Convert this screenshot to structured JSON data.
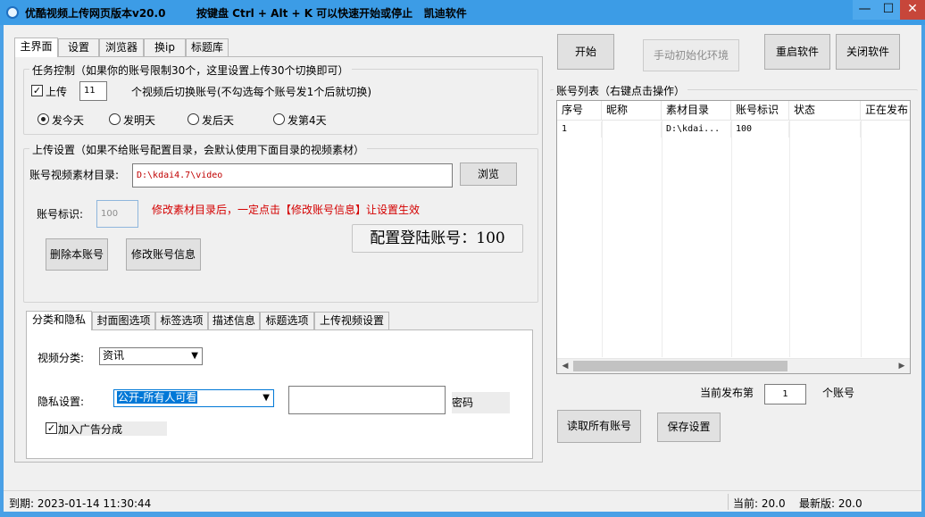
{
  "window": {
    "title": "优酷视频上传网页版本v20.0",
    "hotkey_hint": "按键盘 Ctrl + Alt + K  可以快速开始或停止",
    "company": "凯迪软件",
    "min_glyph": "—",
    "max_glyph": "☐",
    "close_glyph": "✕"
  },
  "tabs": [
    "主界面",
    "设置",
    "浏览器",
    "换ip",
    "标题库"
  ],
  "task_group": {
    "title": "任务控制（如果你的账号限制30个，这里设置上传30个切换即可）",
    "upload_checkbox_label": "上传",
    "upload_count": "11",
    "switch_text": "个视频后切换账号(不勾选每个账号发1个后就切换)",
    "radios": [
      "发今天",
      "发明天",
      "发后天",
      "发第4天"
    ]
  },
  "upload_group": {
    "title": "上传设置（如果不给账号配置目录，会默认使用下面目录的视频素材）",
    "dir_label": "账号视频素材目录:",
    "dir_value": "D:\\kdai4.7\\video",
    "browse_button": "浏览",
    "account_id_label": "账号标识:",
    "account_id_value": "100",
    "warning": "修改素材目录后，一定点击【修改账号信息】让设置生效",
    "delete_button": "删除本账号",
    "modify_button": "修改账号信息",
    "login_account_text": "配置登陆账号：100"
  },
  "subtabs": [
    "分类和隐私",
    "封面图选项",
    "标签选项",
    "描述信息",
    "标题选项",
    "上传视频设置"
  ],
  "category": {
    "label": "视频分类:",
    "selected": "资讯"
  },
  "privacy": {
    "label": "隐私设置:",
    "selected": "公开-所有人可看",
    "password_value": "",
    "password_label": "密码",
    "ad_checkbox_label": "加入广告分成"
  },
  "right_panel": {
    "start_button": "开始",
    "init_button": "手动初始化环境",
    "restart_button": "重启软件",
    "close_button": "关闭软件",
    "list_title": "账号列表（右键点击操作）",
    "columns": [
      "序号",
      "昵称",
      "素材目录",
      "账号标识",
      "状态",
      "正在发布"
    ],
    "rows": [
      [
        "1",
        "",
        "D:\\kdai...",
        "100",
        "",
        ""
      ]
    ],
    "current_publish_label": "当前发布第",
    "current_publish_value": "1",
    "account_unit": "个账号",
    "read_all_button": "读取所有账号",
    "save_button": "保存设置"
  },
  "status": {
    "expire": "到期:  2023-01-14 11:30:44",
    "current": "当前: 20.0",
    "latest": "最新版: 20.0"
  },
  "colors": {
    "titlebar": "#3c9ce6",
    "warning_red": "#d40000",
    "dir_text_red": "#c00000",
    "selection_blue": "#0078d7"
  }
}
